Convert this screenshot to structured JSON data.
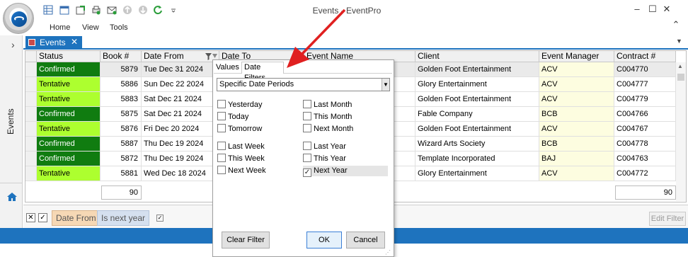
{
  "window": {
    "title": "Events - EventPro",
    "minimize": "–",
    "maximize": "☐",
    "close": "✕",
    "ribbon_toggle": "⌃"
  },
  "quick_access": [
    "grid-icon",
    "calendar-icon",
    "export-icon",
    "print-icon",
    "email-icon",
    "up-icon",
    "down-icon",
    "refresh-icon",
    "customize-icon"
  ],
  "ribbon_tabs": [
    "Home",
    "View",
    "Tools"
  ],
  "side": {
    "label": "Events",
    "collapse": "›"
  },
  "doc_tab": {
    "label": "Events",
    "close": "✕"
  },
  "columns": [
    "Status",
    "Book #",
    "Date From",
    "Date To",
    "Event Name",
    "Client",
    "Event Manager",
    "Contract #"
  ],
  "rows": [
    {
      "status": "Confirmed",
      "book": "5879",
      "date_from": "Tue Dec 31 2024",
      "client": "Golden Foot Entertainment",
      "manager": "ACV",
      "contract": "C004770"
    },
    {
      "status": "Tentative",
      "book": "5886",
      "date_from": "Sun Dec 22 2024",
      "client": "Glory Entertainment",
      "manager": "ACV",
      "contract": "C004777"
    },
    {
      "status": "Tentative",
      "book": "5883",
      "date_from": "Sat Dec 21 2024",
      "client": "Golden Foot Entertainment",
      "manager": "ACV",
      "contract": "C004779"
    },
    {
      "status": "Confirmed",
      "book": "5875",
      "date_from": "Sat Dec 21 2024",
      "client": "Fable Company",
      "manager": "BCB",
      "contract": "C004766"
    },
    {
      "status": "Tentative",
      "book": "5876",
      "date_from": "Fri Dec 20 2024",
      "client": "Golden Foot Entertainment",
      "manager": "ACV",
      "contract": "C004767"
    },
    {
      "status": "Confirmed",
      "book": "5887",
      "date_from": "Thu Dec 19 2024",
      "client": "Wizard Arts Society",
      "manager": "BCB",
      "contract": "C004778"
    },
    {
      "status": "Confirmed",
      "book": "5872",
      "date_from": "Thu Dec 19 2024",
      "client": "Template Incorporated",
      "manager": "BAJ",
      "contract": "C004763"
    },
    {
      "status": "Tentative",
      "book": "5881",
      "date_from": "Wed Dec 18 2024",
      "client": "Glory Entertainment",
      "manager": "ACV",
      "contract": "C004772"
    }
  ],
  "totals": {
    "book": "90",
    "contract": "90"
  },
  "colors": {
    "confirmed": "#107c10",
    "tentative": "#adff2f",
    "accent": "#1e73be"
  },
  "filter_bar": {
    "field": "Date From",
    "condition": "Is next year",
    "edit_label": "Edit Filter",
    "check": "✓",
    "close": "✕"
  },
  "popup": {
    "tab_values": "Values",
    "tab_date_filters": "Date Filters",
    "period_select": "Specific Date Periods",
    "options_left_1": [
      "Yesterday",
      "Today",
      "Tomorrow"
    ],
    "options_left_2": [
      "Last Week",
      "This Week",
      "Next Week"
    ],
    "options_right_1": [
      "Last Month",
      "This Month",
      "Next Month"
    ],
    "options_right_2": [
      "Last Year",
      "This Year",
      "Next Year"
    ],
    "checked": "Next Year",
    "clear_label": "Clear Filter",
    "ok_label": "OK",
    "cancel_label": "Cancel"
  }
}
